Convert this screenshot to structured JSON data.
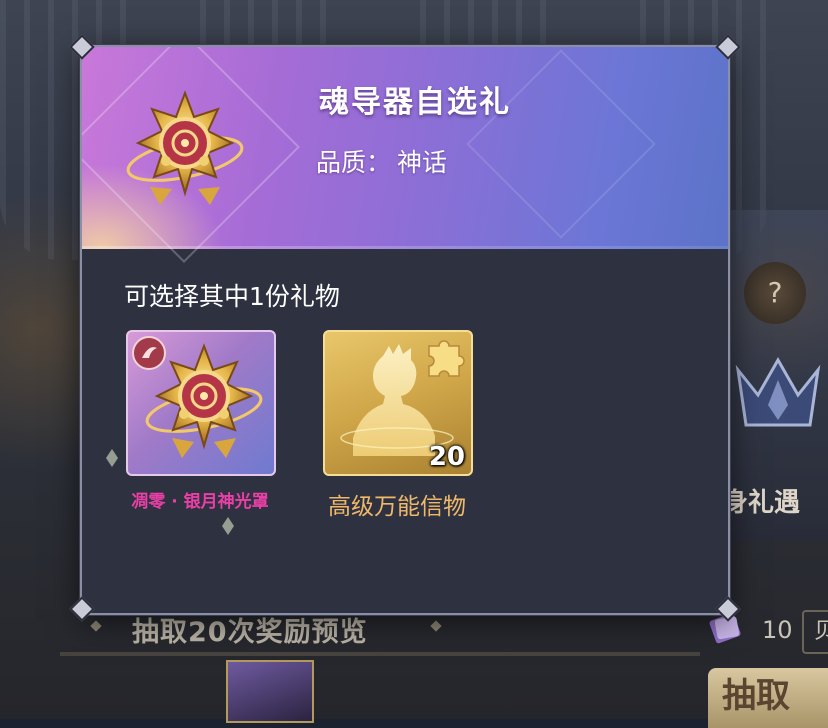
{
  "popup": {
    "title": "魂导器自选礼",
    "quality_label": "品质：",
    "quality_value": "神话",
    "choose_label": "可选择其中1份礼物",
    "items": [
      {
        "name": "凋零 · 银月神光罩",
        "quantity": "",
        "rarity_color": "#ea3fa6"
      },
      {
        "name": "高级万能信物",
        "quantity": "20",
        "rarity_color": "#f0b86a"
      }
    ]
  },
  "background": {
    "bottom_title": "抽取20次奖励预览",
    "right_text": "身礼遇",
    "ticket_count": "10",
    "draw_button": "抽取"
  }
}
